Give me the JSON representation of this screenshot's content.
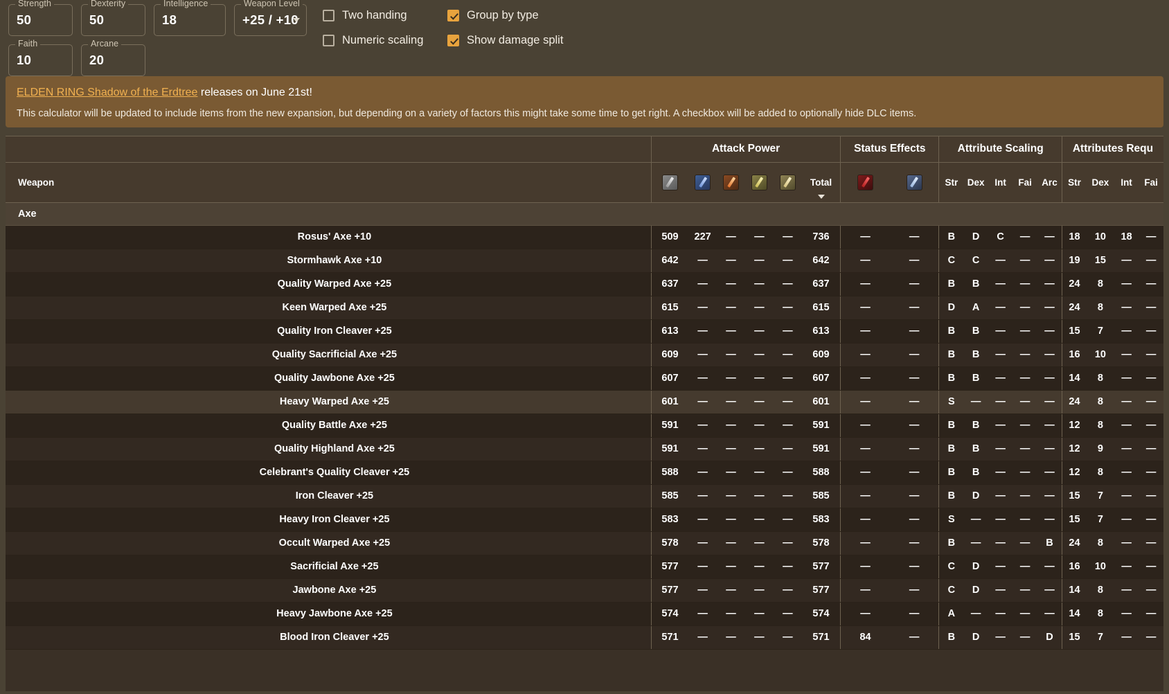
{
  "stats": [
    {
      "label": "Strength",
      "value": "50",
      "name": "strength"
    },
    {
      "label": "Dexterity",
      "value": "50",
      "name": "dexterity"
    },
    {
      "label": "Intelligence",
      "value": "18",
      "name": "intelligence"
    },
    {
      "label": "Weapon Level",
      "value": "+25 / +10",
      "name": "weapon-level"
    },
    {
      "label": "Faith",
      "value": "10",
      "name": "faith"
    },
    {
      "label": "Arcane",
      "value": "20",
      "name": "arcane"
    }
  ],
  "checkboxes": [
    {
      "label": "Two handing",
      "checked": false,
      "name": "two-handing"
    },
    {
      "label": "Group by type",
      "checked": true,
      "name": "group-by-type"
    },
    {
      "label": "Numeric scaling",
      "checked": false,
      "name": "numeric-scaling"
    },
    {
      "label": "Show damage split",
      "checked": true,
      "name": "show-damage-split"
    }
  ],
  "banner": {
    "link_text": "ELDEN RING Shadow of the Erdtree",
    "title_rest": " releases on June 21st!",
    "body": "This calculator will be updated to include items from the new expansion, but depending on a variety of factors this might take some time to get right. A checkbox will be added to optionally hide DLC items."
  },
  "table": {
    "groups": {
      "weapon": "Weapon",
      "attack_power": "Attack Power",
      "status_effects": "Status Effects",
      "attribute_scaling": "Attribute Scaling",
      "attributes_required": "Attributes Requ"
    },
    "attack_icons": [
      "physical-damage-icon",
      "magic-damage-icon",
      "fire-damage-icon",
      "lightning-damage-icon",
      "holy-damage-icon"
    ],
    "total_label": "Total",
    "status_icons": [
      "bleed-status-icon",
      "frost-status-icon"
    ],
    "scaling_headers": [
      "Str",
      "Dex",
      "Int",
      "Fai",
      "Arc"
    ],
    "required_headers": [
      "Str",
      "Dex",
      "Int",
      "Fai"
    ],
    "group_label": "Axe",
    "sort_column": "Total",
    "sort_direction": "descending",
    "rows": [
      {
        "name": "Rosus' Axe +10",
        "phys": "509",
        "magic": "227",
        "fire": "—",
        "lightning": "—",
        "holy": "—",
        "total": "736",
        "bleed": "—",
        "frost": "—",
        "scaling": [
          "B",
          "D",
          "C",
          "—",
          "—"
        ],
        "required": [
          "18",
          "10",
          "18",
          "—"
        ]
      },
      {
        "name": "Stormhawk Axe +10",
        "phys": "642",
        "magic": "—",
        "fire": "—",
        "lightning": "—",
        "holy": "—",
        "total": "642",
        "bleed": "—",
        "frost": "—",
        "scaling": [
          "C",
          "C",
          "—",
          "—",
          "—"
        ],
        "required": [
          "19",
          "15",
          "—",
          "—"
        ]
      },
      {
        "name": "Quality Warped Axe +25",
        "phys": "637",
        "magic": "—",
        "fire": "—",
        "lightning": "—",
        "holy": "—",
        "total": "637",
        "bleed": "—",
        "frost": "—",
        "scaling": [
          "B",
          "B",
          "—",
          "—",
          "—"
        ],
        "required": [
          "24",
          "8",
          "—",
          "—"
        ]
      },
      {
        "name": "Keen Warped Axe +25",
        "phys": "615",
        "magic": "—",
        "fire": "—",
        "lightning": "—",
        "holy": "—",
        "total": "615",
        "bleed": "—",
        "frost": "—",
        "scaling": [
          "D",
          "A",
          "—",
          "—",
          "—"
        ],
        "required": [
          "24",
          "8",
          "—",
          "—"
        ]
      },
      {
        "name": "Quality Iron Cleaver +25",
        "phys": "613",
        "magic": "—",
        "fire": "—",
        "lightning": "—",
        "holy": "—",
        "total": "613",
        "bleed": "—",
        "frost": "—",
        "scaling": [
          "B",
          "B",
          "—",
          "—",
          "—"
        ],
        "required": [
          "15",
          "7",
          "—",
          "—"
        ]
      },
      {
        "name": "Quality Sacrificial Axe +25",
        "phys": "609",
        "magic": "—",
        "fire": "—",
        "lightning": "—",
        "holy": "—",
        "total": "609",
        "bleed": "—",
        "frost": "—",
        "scaling": [
          "B",
          "B",
          "—",
          "—",
          "—"
        ],
        "required": [
          "16",
          "10",
          "—",
          "—"
        ]
      },
      {
        "name": "Quality Jawbone Axe +25",
        "phys": "607",
        "magic": "—",
        "fire": "—",
        "lightning": "—",
        "holy": "—",
        "total": "607",
        "bleed": "—",
        "frost": "—",
        "scaling": [
          "B",
          "B",
          "—",
          "—",
          "—"
        ],
        "required": [
          "14",
          "8",
          "—",
          "—"
        ]
      },
      {
        "name": "Heavy Warped Axe +25",
        "phys": "601",
        "magic": "—",
        "fire": "—",
        "lightning": "—",
        "holy": "—",
        "total": "601",
        "bleed": "—",
        "frost": "—",
        "scaling": [
          "S",
          "—",
          "—",
          "—",
          "—"
        ],
        "required": [
          "24",
          "8",
          "—",
          "—"
        ],
        "highlight": true
      },
      {
        "name": "Quality Battle Axe +25",
        "phys": "591",
        "magic": "—",
        "fire": "—",
        "lightning": "—",
        "holy": "—",
        "total": "591",
        "bleed": "—",
        "frost": "—",
        "scaling": [
          "B",
          "B",
          "—",
          "—",
          "—"
        ],
        "required": [
          "12",
          "8",
          "—",
          "—"
        ]
      },
      {
        "name": "Quality Highland Axe +25",
        "phys": "591",
        "magic": "—",
        "fire": "—",
        "lightning": "—",
        "holy": "—",
        "total": "591",
        "bleed": "—",
        "frost": "—",
        "scaling": [
          "B",
          "B",
          "—",
          "—",
          "—"
        ],
        "required": [
          "12",
          "9",
          "—",
          "—"
        ]
      },
      {
        "name": "Celebrant's Quality Cleaver +25",
        "phys": "588",
        "magic": "—",
        "fire": "—",
        "lightning": "—",
        "holy": "—",
        "total": "588",
        "bleed": "—",
        "frost": "—",
        "scaling": [
          "B",
          "B",
          "—",
          "—",
          "—"
        ],
        "required": [
          "12",
          "8",
          "—",
          "—"
        ]
      },
      {
        "name": "Iron Cleaver +25",
        "phys": "585",
        "magic": "—",
        "fire": "—",
        "lightning": "—",
        "holy": "—",
        "total": "585",
        "bleed": "—",
        "frost": "—",
        "scaling": [
          "B",
          "D",
          "—",
          "—",
          "—"
        ],
        "required": [
          "15",
          "7",
          "—",
          "—"
        ]
      },
      {
        "name": "Heavy Iron Cleaver +25",
        "phys": "583",
        "magic": "—",
        "fire": "—",
        "lightning": "—",
        "holy": "—",
        "total": "583",
        "bleed": "—",
        "frost": "—",
        "scaling": [
          "S",
          "—",
          "—",
          "—",
          "—"
        ],
        "required": [
          "15",
          "7",
          "—",
          "—"
        ]
      },
      {
        "name": "Occult Warped Axe +25",
        "phys": "578",
        "magic": "—",
        "fire": "—",
        "lightning": "—",
        "holy": "—",
        "total": "578",
        "bleed": "—",
        "frost": "—",
        "scaling": [
          "B",
          "—",
          "—",
          "—",
          "B"
        ],
        "required": [
          "24",
          "8",
          "—",
          "—"
        ]
      },
      {
        "name": "Sacrificial Axe +25",
        "phys": "577",
        "magic": "—",
        "fire": "—",
        "lightning": "—",
        "holy": "—",
        "total": "577",
        "bleed": "—",
        "frost": "—",
        "scaling": [
          "C",
          "D",
          "—",
          "—",
          "—"
        ],
        "required": [
          "16",
          "10",
          "—",
          "—"
        ]
      },
      {
        "name": "Jawbone Axe +25",
        "phys": "577",
        "magic": "—",
        "fire": "—",
        "lightning": "—",
        "holy": "—",
        "total": "577",
        "bleed": "—",
        "frost": "—",
        "scaling": [
          "C",
          "D",
          "—",
          "—",
          "—"
        ],
        "required": [
          "14",
          "8",
          "—",
          "—"
        ]
      },
      {
        "name": "Heavy Jawbone Axe +25",
        "phys": "574",
        "magic": "—",
        "fire": "—",
        "lightning": "—",
        "holy": "—",
        "total": "574",
        "bleed": "—",
        "frost": "—",
        "scaling": [
          "A",
          "—",
          "—",
          "—",
          "—"
        ],
        "required": [
          "14",
          "8",
          "—",
          "—"
        ]
      },
      {
        "name": "Blood Iron Cleaver +25",
        "phys": "571",
        "magic": "—",
        "fire": "—",
        "lightning": "—",
        "holy": "—",
        "total": "571",
        "bleed": "84",
        "frost": "—",
        "scaling": [
          "B",
          "D",
          "—",
          "—",
          "D"
        ],
        "required": [
          "15",
          "7",
          "—",
          "—"
        ]
      }
    ]
  }
}
